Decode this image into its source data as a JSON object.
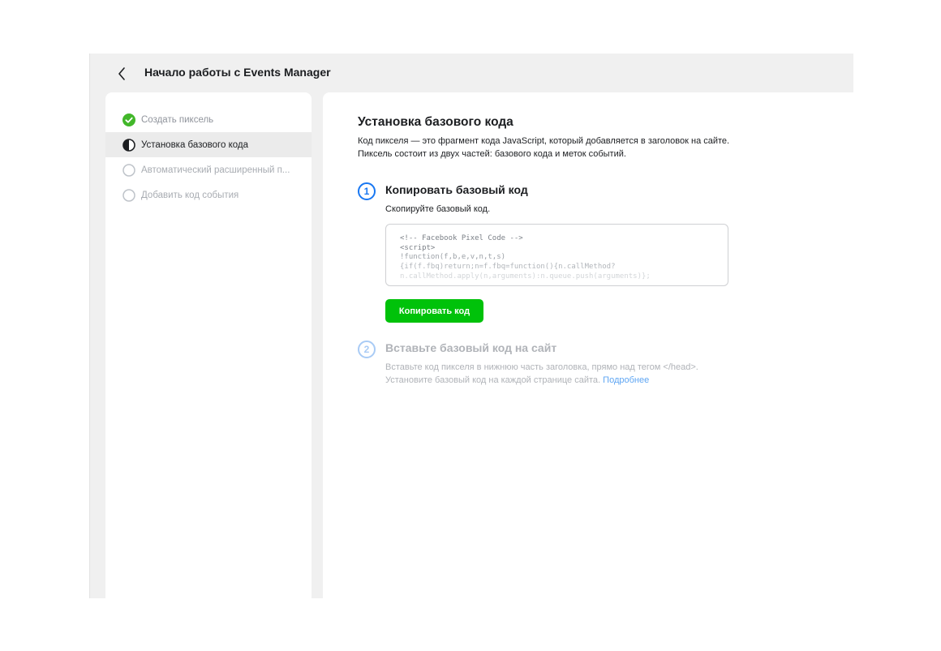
{
  "topbar": {
    "back_icon": "chevron-left-icon",
    "title": "Начало работы с Events Manager"
  },
  "sidebar": {
    "steps": [
      {
        "label": "Создать пиксель",
        "state": "done",
        "icon": "check-circle-icon"
      },
      {
        "label": "Установка базового кода",
        "state": "active",
        "icon": "half-circle-icon"
      },
      {
        "label": "Автоматический расширенный п...",
        "state": "pending",
        "icon": "empty-circle-icon"
      },
      {
        "label": "Добавить код события",
        "state": "pending",
        "icon": "empty-circle-icon"
      }
    ]
  },
  "main": {
    "title": "Установка базового кода",
    "description_line1": "Код пикселя — это фрагмент кода JavaScript, который добавляется в заголовок на сайте.",
    "description_line2": "Пиксель состоит из двух частей: базового кода и меток событий.",
    "step1": {
      "number": "1",
      "title": "Копировать базовый код",
      "subtitle": "Скопируйте базовый код.",
      "code_lines": [
        "<!-- Facebook Pixel Code -->",
        "<script>",
        "!function(f,b,e,v,n,t,s)",
        "{if(f.fbq)return;n=f.fbq=function(){n.callMethod?",
        "n.callMethod.apply(n,arguments):n.queue.push(arguments)};"
      ],
      "button_label": "Копировать код"
    },
    "step2": {
      "number": "2",
      "title": "Вставьте базовый код на сайт",
      "line1": "Вставьте код пикселя в нижнюю часть заголовка, прямо над тегом </head>.",
      "line2": "Установите базовый код на каждой странице сайта.",
      "link": "Подробнее"
    }
  },
  "colors": {
    "accent_blue": "#1877f2",
    "success_green": "#00c20a",
    "link_blue": "#5fa6f3"
  }
}
